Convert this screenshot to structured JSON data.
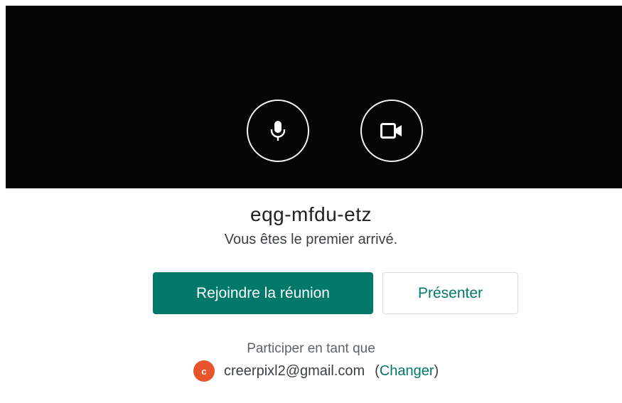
{
  "preview": {
    "mic_icon": "microphone-icon",
    "camera_icon": "video-camera-icon",
    "background_color": "#050505"
  },
  "meeting": {
    "code": "eqg-mfdu-etz",
    "status": "Vous êtes le premier arrivé."
  },
  "actions": {
    "join_label": "Rejoindre la réunion",
    "present_label": "Présenter",
    "accent_color": "#00796b"
  },
  "account": {
    "join_as_label": "Participer en tant que",
    "avatar_letter": "c",
    "avatar_color": "#e8542b",
    "email": "creerpixl2@gmail.com",
    "open_paren": "(",
    "change_label": "Changer",
    "close_paren": ")"
  }
}
